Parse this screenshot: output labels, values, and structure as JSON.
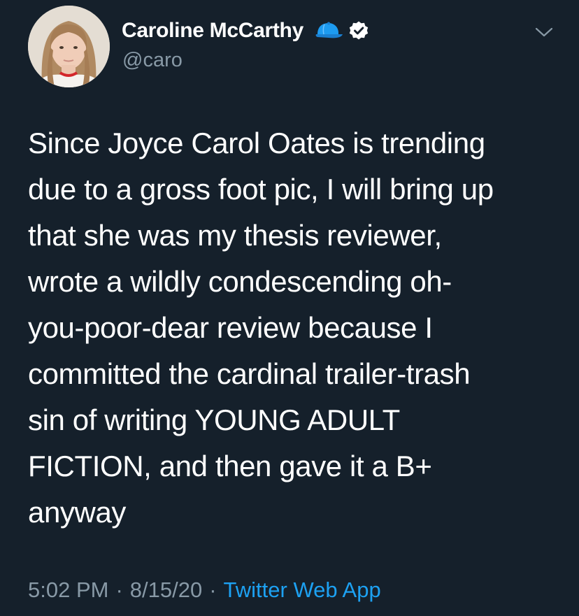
{
  "author": {
    "display_name": "Caroline McCarthy",
    "handle": "@caro",
    "avatar_icon": "profile-photo",
    "badges": [
      "baseball-cap-icon",
      "verified-icon"
    ]
  },
  "tweet": {
    "text": "Since Joyce Carol Oates is trending\ndue to a gross foot pic, I will bring up\nthat she was my thesis reviewer,\nwrote a wildly condescending oh-\nyou-poor-dear review because I\ncommitted the cardinal trailer-trash\nsin of writing YOUNG ADULT\nFICTION, and then gave it a B+\nanyway",
    "time": "5:02 PM",
    "date": "8/15/20",
    "separator": "·",
    "source": "Twitter Web App"
  },
  "colors": {
    "background": "#15202b",
    "text_primary": "#ffffff",
    "text_secondary": "#8899a6",
    "link": "#1da1f2",
    "cap_blue": "#1d9bf0"
  }
}
